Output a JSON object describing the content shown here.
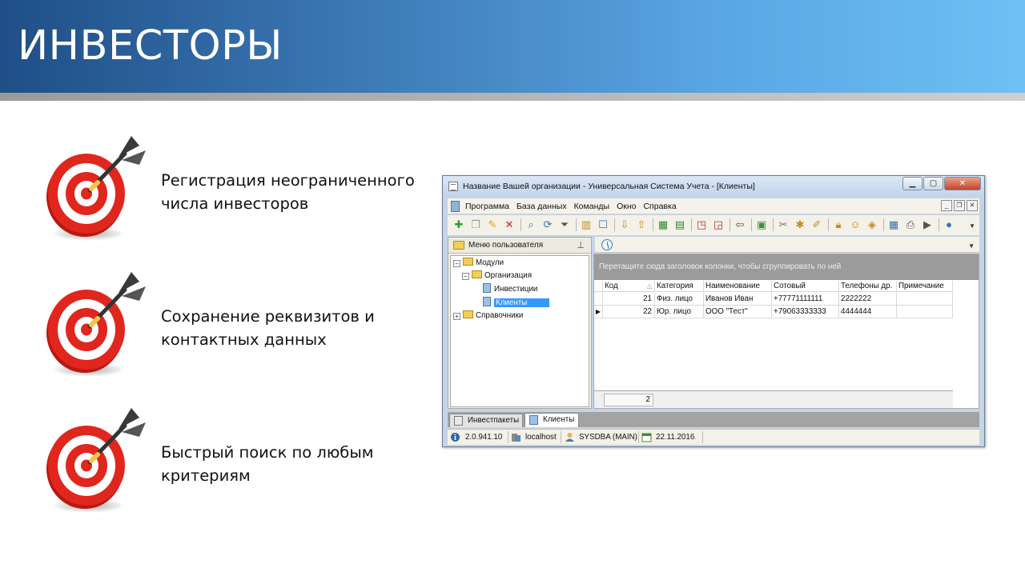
{
  "slide": {
    "title": "ИНВЕСТОРЫ",
    "bullets": [
      {
        "line1": "Регистрация неограниченного",
        "line2": "числа инвесторов"
      },
      {
        "line1": "Сохранение реквизитов и",
        "line2": "контактных данных"
      },
      {
        "line1": "Быстрый поиск по любым",
        "line2": "критериям"
      }
    ]
  },
  "window": {
    "title": "Название Вашей организации - Универсальная Система Учета - [Клиенты]",
    "menu": [
      "Программа",
      "База данных",
      "Команды",
      "Окно",
      "Справка"
    ],
    "left_pane": {
      "title": "Меню пользователя",
      "tree": {
        "modules": "Модули",
        "organization": "Организация",
        "investments": "Инвестиции",
        "clients": "Клиенты",
        "references": "Справочники"
      }
    },
    "grid": {
      "group_hint": "Перетащите сюда заголовок колонки, чтобы сгруппировать по ней",
      "columns": [
        "Код",
        "Категория",
        "Наименование",
        "Сотовый",
        "Телефоны др.",
        "Примечание"
      ],
      "rows": [
        {
          "code": "21",
          "category": "Физ. лицо",
          "name": "Иванов Иван",
          "mobile": "+77771111111",
          "phones": "2222222",
          "note": ""
        },
        {
          "code": "22",
          "category": "Юр. лицо",
          "name": "ООО \"Тест\"",
          "mobile": "+79063333333",
          "phones": "4444444",
          "note": ""
        }
      ],
      "footer_count": "2"
    },
    "tabs": [
      "Инвестпакеты",
      "Клиенты"
    ],
    "status": {
      "version": "2.0.941.10",
      "host": "localhost",
      "user": "SYSDBA (MAIN)",
      "date": "22.11.2016"
    }
  },
  "colors": {
    "banner_dark": "#1f4f86",
    "banner_light": "#6ec0f6",
    "target_red": "#d9231c",
    "selection": "#3399ff"
  }
}
